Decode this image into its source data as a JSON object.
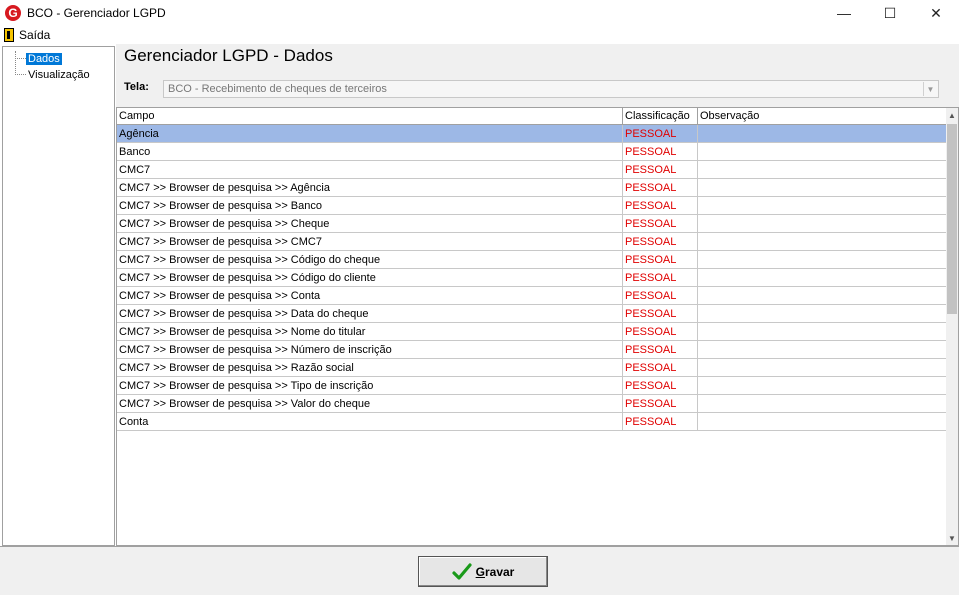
{
  "window": {
    "title": "BCO - Gerenciador LGPD",
    "logo_letter": "G",
    "minimize": "—",
    "maximize": "☐",
    "close": "✕"
  },
  "menu": {
    "exit_label": "Saída"
  },
  "tree": {
    "items": [
      "Dados",
      "Visualização"
    ]
  },
  "main": {
    "title": "Gerenciador LGPD - Dados",
    "tela_label": "Tela:",
    "tela_value": "BCO - Recebimento de cheques de terceiros"
  },
  "grid": {
    "columns": [
      "Campo",
      "Classificação",
      "Observação"
    ],
    "rows": [
      {
        "campo": "Agência",
        "classificacao": "PESSOAL",
        "observacao": ""
      },
      {
        "campo": "Banco",
        "classificacao": "PESSOAL",
        "observacao": ""
      },
      {
        "campo": "CMC7",
        "classificacao": "PESSOAL",
        "observacao": ""
      },
      {
        "campo": "CMC7 >> Browser de pesquisa >> Agência",
        "classificacao": "PESSOAL",
        "observacao": ""
      },
      {
        "campo": "CMC7 >> Browser de pesquisa >> Banco",
        "classificacao": "PESSOAL",
        "observacao": ""
      },
      {
        "campo": "CMC7 >> Browser de pesquisa >> Cheque",
        "classificacao": "PESSOAL",
        "observacao": ""
      },
      {
        "campo": "CMC7 >> Browser de pesquisa >> CMC7",
        "classificacao": "PESSOAL",
        "observacao": ""
      },
      {
        "campo": "CMC7 >> Browser de pesquisa >> Código do cheque",
        "classificacao": "PESSOAL",
        "observacao": ""
      },
      {
        "campo": "CMC7 >> Browser de pesquisa >> Código do cliente",
        "classificacao": "PESSOAL",
        "observacao": ""
      },
      {
        "campo": "CMC7 >> Browser de pesquisa >> Conta",
        "classificacao": "PESSOAL",
        "observacao": ""
      },
      {
        "campo": "CMC7 >> Browser de pesquisa >> Data do cheque",
        "classificacao": "PESSOAL",
        "observacao": ""
      },
      {
        "campo": "CMC7 >> Browser de pesquisa >> Nome do titular",
        "classificacao": "PESSOAL",
        "observacao": ""
      },
      {
        "campo": "CMC7 >> Browser de pesquisa >> Número de inscrição",
        "classificacao": "PESSOAL",
        "observacao": ""
      },
      {
        "campo": "CMC7 >> Browser de pesquisa >> Razão social",
        "classificacao": "PESSOAL",
        "observacao": ""
      },
      {
        "campo": "CMC7 >> Browser de pesquisa >> Tipo de inscrição",
        "classificacao": "PESSOAL",
        "observacao": ""
      },
      {
        "campo": "CMC7 >> Browser de pesquisa >> Valor do cheque",
        "classificacao": "PESSOAL",
        "observacao": ""
      },
      {
        "campo": "Conta",
        "classificacao": "PESSOAL",
        "observacao": ""
      }
    ]
  },
  "footer": {
    "gravar_first": "G",
    "gravar_rest": "ravar"
  },
  "colors": {
    "classification": "#e00000",
    "selected_row": "#9db8e6",
    "logo": "#d71920"
  }
}
